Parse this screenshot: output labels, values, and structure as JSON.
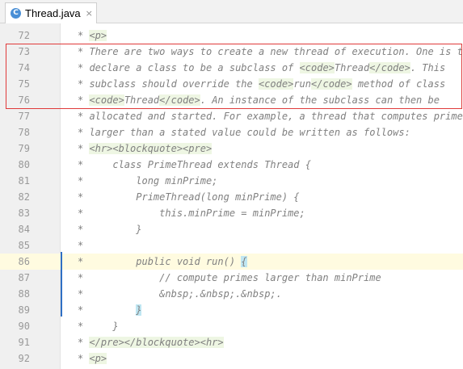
{
  "tab": {
    "label": "Thread.java",
    "icon": "c-class-icon",
    "icon_letter": "C",
    "close": "×"
  },
  "colors": {
    "highlight_box": "#e03a3a",
    "comment": "#808080",
    "tag_bg": "#eef6e3",
    "brace_bg": "#bfe6f2",
    "current_line_bg": "#fffbe0"
  },
  "lines": [
    {
      "num": "72",
      "segs": [
        {
          "t": "* "
        },
        {
          "t": "<p>",
          "c": "tag"
        }
      ]
    },
    {
      "num": "73",
      "segs": [
        {
          "t": "* There are two ways to create a new thread of execution. One is to"
        }
      ]
    },
    {
      "num": "74",
      "segs": [
        {
          "t": "* declare a class to be a subclass of "
        },
        {
          "t": "<code>",
          "c": "tag"
        },
        {
          "t": "Thread"
        },
        {
          "t": "</code>",
          "c": "tag"
        },
        {
          "t": ". This"
        }
      ]
    },
    {
      "num": "75",
      "segs": [
        {
          "t": "* subclass should override the "
        },
        {
          "t": "<code>",
          "c": "tag"
        },
        {
          "t": "run"
        },
        {
          "t": "</code>",
          "c": "tag"
        },
        {
          "t": " method of class"
        }
      ]
    },
    {
      "num": "76",
      "segs": [
        {
          "t": "* "
        },
        {
          "t": "<code>",
          "c": "tag"
        },
        {
          "t": "Thread"
        },
        {
          "t": "</code>",
          "c": "tag"
        },
        {
          "t": ". An instance of the subclass can then be"
        }
      ]
    },
    {
      "num": "77",
      "segs": [
        {
          "t": "* allocated and started. For example, a thread that computes primes"
        }
      ]
    },
    {
      "num": "78",
      "segs": [
        {
          "t": "* larger than a stated value could be written as follows:"
        }
      ]
    },
    {
      "num": "79",
      "segs": [
        {
          "t": "* "
        },
        {
          "t": "<hr><blockquote><pre>",
          "c": "tag"
        }
      ]
    },
    {
      "num": "80",
      "segs": [
        {
          "t": "*     class PrimeThread extends Thread {"
        }
      ]
    },
    {
      "num": "81",
      "segs": [
        {
          "t": "*         long minPrime;"
        }
      ]
    },
    {
      "num": "82",
      "segs": [
        {
          "t": "*         PrimeThread(long minPrime) {"
        }
      ]
    },
    {
      "num": "83",
      "segs": [
        {
          "t": "*             this.minPrime = minPrime;"
        }
      ]
    },
    {
      "num": "84",
      "segs": [
        {
          "t": "*         }"
        }
      ]
    },
    {
      "num": "85",
      "segs": [
        {
          "t": "*"
        }
      ]
    },
    {
      "num": "86",
      "current": true,
      "segs": [
        {
          "t": "*         public void run() "
        },
        {
          "t": "{",
          "c": "brace"
        }
      ]
    },
    {
      "num": "87",
      "segs": [
        {
          "t": "*             // compute primes larger than minPrime"
        }
      ]
    },
    {
      "num": "88",
      "segs": [
        {
          "t": "*             &nbsp;.&nbsp;.&nbsp;."
        }
      ]
    },
    {
      "num": "89",
      "segs": [
        {
          "t": "*         "
        },
        {
          "t": "}",
          "c": "brace"
        }
      ]
    },
    {
      "num": "90",
      "segs": [
        {
          "t": "*     }"
        }
      ]
    },
    {
      "num": "91",
      "segs": [
        {
          "t": "* "
        },
        {
          "t": "</pre></blockquote><hr>",
          "c": "tag"
        }
      ]
    },
    {
      "num": "92",
      "segs": [
        {
          "t": "* "
        },
        {
          "t": "<p>",
          "c": "tag"
        }
      ]
    }
  ]
}
